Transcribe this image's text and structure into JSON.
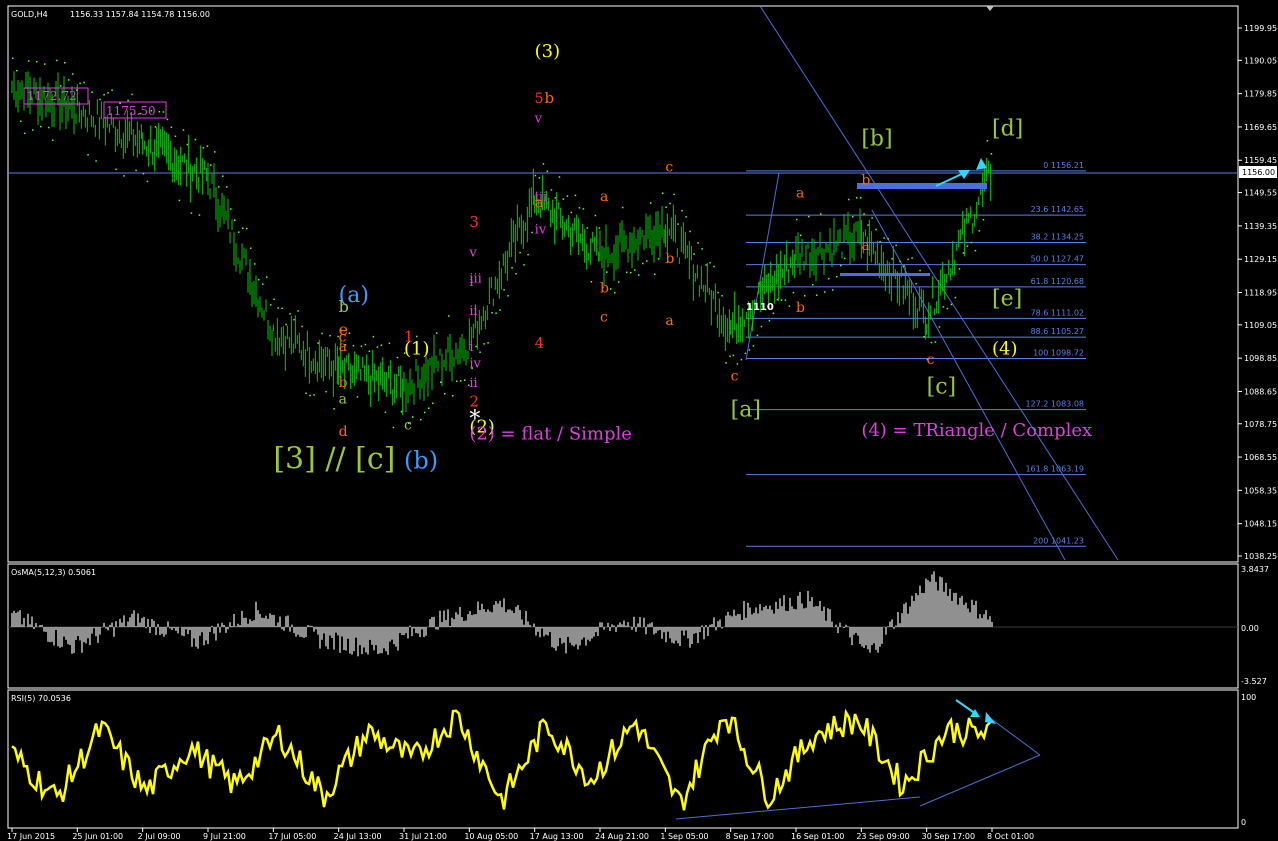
{
  "header": {
    "symbol": "GOLD,H4",
    "ohlc": "1156.33 1157.84 1154.78 1156.00"
  },
  "price_scale": {
    "ticks": [
      "1199.95",
      "1190.05",
      "1179.85",
      "1169.65",
      "1159.45",
      "1149.55",
      "1139.35",
      "1129.15",
      "1118.95",
      "1109.05",
      "1098.85",
      "1088.65",
      "1078.75",
      "1068.55",
      "1058.35",
      "1048.15",
      "1038.25"
    ],
    "current": "1156.00"
  },
  "time_axis": [
    "17 Jun 2015",
    "25 Jun 01:00",
    "2 Jul 09:00",
    "9 Jul 21:00",
    "17 Jul 05:00",
    "24 Jul 13:00",
    "31 Jul 21:00",
    "10 Aug 05:00",
    "17 Aug 13:00",
    "24 Aug 21:00",
    "1 Sep 05:00",
    "8 Sep 17:00",
    "16 Sep 01:00",
    "23 Sep 09:00",
    "30 Sep 17:00",
    "8 Oct 01:00"
  ],
  "price_tags": [
    "1172.72",
    "1175.50"
  ],
  "level_label": "1110",
  "fib_levels": [
    {
      "label": "0 1156.21",
      "price": 1156.21
    },
    {
      "label": "23.6 1142.65",
      "price": 1142.65
    },
    {
      "label": "38.2 1134.25",
      "price": 1134.25
    },
    {
      "label": "50.0 1127.47",
      "price": 1127.47
    },
    {
      "label": "61.8 1120.68",
      "price": 1120.68
    },
    {
      "label": "78.6 1111.02",
      "price": 1111.02
    },
    {
      "label": "88.6 1105.27",
      "price": 1105.27
    },
    {
      "label": "100 1098.72",
      "price": 1098.72
    },
    {
      "label": "127.2 1083.08",
      "price": 1083.08
    },
    {
      "label": "161.8 1063.19",
      "price": 1063.19
    },
    {
      "label": "200 1041.23",
      "price": 1041.23
    }
  ],
  "annotations": [
    {
      "text": "(3)",
      "color": "#ffff00",
      "size": 18,
      "x_date": "17 Aug 13:00",
      "price": 1191
    },
    {
      "text": "5",
      "color": "#ff3030",
      "size": 14,
      "x_date": "17 Aug 13:00",
      "price": 1177
    },
    {
      "text": "b",
      "color": "#ff6a00",
      "size": 15,
      "x_date": "17 Aug 13:00",
      "price": 1177
    },
    {
      "text": "v",
      "color": "#e040e0",
      "size": 13,
      "x_date": "17 Aug 13:00",
      "price": 1171
    },
    {
      "text": "iii",
      "color": "#e040e0",
      "size": 13,
      "x_date": "17 Aug 13:00",
      "price": 1147
    },
    {
      "text": "a",
      "color": "#ff6a00",
      "size": 15,
      "x_date": "17 Aug 13:00",
      "price": 1145
    },
    {
      "text": "iv",
      "color": "#e040e0",
      "size": 13,
      "x_date": "17 Aug 13:00",
      "price": 1137
    },
    {
      "text": "3",
      "color": "#ff3030",
      "size": 15,
      "x_date": "10 Aug 05:00",
      "price": 1139
    },
    {
      "text": "v",
      "color": "#e040e0",
      "size": 13,
      "x_date": "10 Aug 05:00",
      "price": 1130
    },
    {
      "text": "iii",
      "color": "#e040e0",
      "size": 13,
      "x_date": "10 Aug 05:00",
      "price": 1122
    },
    {
      "text": "i",
      "color": "#e040e0",
      "size": 13,
      "x_date": "10 Aug 05:00",
      "price": 1121
    },
    {
      "text": "ii",
      "color": "#e040e0",
      "size": 13,
      "x_date": "10 Aug 05:00",
      "price": 1112
    },
    {
      "text": "4",
      "color": "#ff3030",
      "size": 15,
      "x_date": "17 Aug 13:00",
      "price": 1102
    },
    {
      "text": "1",
      "color": "#ff3030",
      "size": 15,
      "x_date": "31 Jul 21:00",
      "price": 1104
    },
    {
      "text": "i",
      "color": "#e040e0",
      "size": 13,
      "x_date": "10 Aug 05:00",
      "price": 1101
    },
    {
      "text": "iv",
      "color": "#e040e0",
      "size": 13,
      "x_date": "10 Aug 05:00",
      "price": 1096
    },
    {
      "text": "ii",
      "color": "#e040e0",
      "size": 13,
      "x_date": "10 Aug 05:00",
      "price": 1090
    },
    {
      "text": "2",
      "color": "#ff3030",
      "size": 15,
      "x_date": "10 Aug 05:00",
      "price": 1084
    },
    {
      "text": "*",
      "color": "#ffffff",
      "size": 22,
      "x_date": "10 Aug 05:00",
      "price": 1078
    },
    {
      "text": "(2)",
      "color": "#ffff00",
      "size": 18,
      "x_date": "10 Aug 05:00",
      "price": 1076
    },
    {
      "text": "(1)",
      "color": "#ffff00",
      "size": 18,
      "x_date": "31 Jul 21:00",
      "price": 1100
    },
    {
      "text": "(2) = flat / Simple",
      "color": "#e040e0",
      "size": 18,
      "x_date": "10 Aug 05:00",
      "price": 1074
    },
    {
      "text": "(a)",
      "color": "#3a9cff",
      "size": 22,
      "x_date": "24 Jul 13:00",
      "price": 1116
    },
    {
      "text": "b",
      "color": "#9ac832",
      "size": 16,
      "x_date": "24 Jul 13:00",
      "price": 1113
    },
    {
      "text": "e",
      "color": "#ff6a00",
      "size": 16,
      "x_date": "24 Jul 13:00",
      "price": 1106
    },
    {
      "text": "c",
      "color": "#ff6a00",
      "size": 14,
      "x_date": "24 Jul 13:00",
      "price": 1104
    },
    {
      "text": "a",
      "color": "#ff6a00",
      "size": 14,
      "x_date": "24 Jul 13:00",
      "price": 1101
    },
    {
      "text": "b",
      "color": "#ff6a00",
      "size": 14,
      "x_date": "24 Jul 13:00",
      "price": 1090
    },
    {
      "text": "a",
      "color": "#9ac832",
      "size": 14,
      "x_date": "24 Jul 13:00",
      "price": 1085
    },
    {
      "text": "d",
      "color": "#ff6a00",
      "size": 14,
      "x_date": "24 Jul 13:00",
      "price": 1075
    },
    {
      "text": "c",
      "color": "#9ac832",
      "size": 14,
      "x_date": "31 Jul 21:00",
      "price": 1077
    },
    {
      "text": "[3] // [c]",
      "color": "#9ac832",
      "size": 30,
      "x_date": "17 Jul 05:00",
      "price": 1065
    },
    {
      "text": "(b)",
      "color": "#3a9cff",
      "size": 24,
      "x_date": "31 Jul 21:00",
      "price": 1065
    },
    {
      "text": "c",
      "color": "#ff6a00",
      "size": 14,
      "x_date": "24 Aug 21:00",
      "price": 1110
    },
    {
      "text": "b",
      "color": "#ff6a00",
      "size": 14,
      "x_date": "24 Aug 21:00",
      "price": 1119
    },
    {
      "text": "a",
      "color": "#ff6a00",
      "size": 14,
      "x_date": "24 Aug 21:00",
      "price": 1147
    },
    {
      "text": "c",
      "color": "#ff6a00",
      "size": 14,
      "x_date": "1 Sep 05:00",
      "price": 1156
    },
    {
      "text": "b",
      "color": "#ff6a00",
      "size": 14,
      "x_date": "1 Sep 05:00",
      "price": 1128
    },
    {
      "text": "a",
      "color": "#ff6a00",
      "size": 14,
      "x_date": "1 Sep 05:00",
      "price": 1109
    },
    {
      "text": "c",
      "color": "#ff6a00",
      "size": 14,
      "x_date": "8 Sep 17:00",
      "price": 1092
    },
    {
      "text": "[a]",
      "color": "#9ac832",
      "size": 22,
      "x_date": "8 Sep 17:00",
      "price": 1081
    },
    {
      "text": "a",
      "color": "#ff6a00",
      "size": 14,
      "x_date": "16 Sep 01:00",
      "price": 1148
    },
    {
      "text": "b",
      "color": "#ff6a00",
      "size": 14,
      "x_date": "16 Sep 01:00",
      "price": 1113
    },
    {
      "text": "[b]",
      "color": "#9ac832",
      "size": 22,
      "x_date": "23 Sep 09:00",
      "price": 1164
    },
    {
      "text": "b",
      "color": "#ff6a00",
      "size": 14,
      "x_date": "23 Sep 09:00",
      "price": 1152
    },
    {
      "text": "a",
      "color": "#ff6a00",
      "size": 14,
      "x_date": "23 Sep 09:00",
      "price": 1132
    },
    {
      "text": "c",
      "color": "#ff6a00",
      "size": 14,
      "x_date": "30 Sep 17:00",
      "price": 1097
    },
    {
      "text": "[c]",
      "color": "#9ac832",
      "size": 22,
      "x_date": "30 Sep 17:00",
      "price": 1088
    },
    {
      "text": "[d]",
      "color": "#9ac832",
      "size": 22,
      "x_date": "8 Oct 01:00",
      "price": 1167
    },
    {
      "text": "[e]",
      "color": "#9ac832",
      "size": 22,
      "x_date": "8 Oct 01:00",
      "price": 1115
    },
    {
      "text": "(4)",
      "color": "#ffff00",
      "size": 18,
      "x_date": "8 Oct 01:00",
      "price": 1100
    },
    {
      "text": "(4) = TRiangle / Complex",
      "color": "#e040e0",
      "size": 18,
      "x_date": "23 Sep 09:00",
      "price": 1075
    }
  ],
  "osma": {
    "title": "OsMA(5,12,3) 0.5061",
    "ticks": [
      "3.8437",
      "0.00",
      "-3.527"
    ]
  },
  "rsi": {
    "title": "RSI(5) 70.0536",
    "ticks": [
      "100",
      "0"
    ]
  },
  "colors": {
    "bg": "#000000",
    "grid": "#3a3a3a",
    "frame": "#ffffff",
    "candles": "#00cc00",
    "psar": "#66ff33",
    "fib": "#5a7ee6",
    "rsi": "#ffff00",
    "osma": "#c0c0c0",
    "trend": "#4a6fd4",
    "accent": "#33d6ff",
    "box": "#4a6fe0"
  },
  "chart_data": {
    "type": "line",
    "title": "GOLD,H4",
    "x_labels": [
      "17 Jun 2015",
      "25 Jun 01:00",
      "2 Jul 09:00",
      "9 Jul 21:00",
      "17 Jul 05:00",
      "24 Jul 13:00",
      "31 Jul 21:00",
      "10 Aug 05:00",
      "17 Aug 13:00",
      "24 Aug 21:00",
      "1 Sep 05:00",
      "8 Sep 17:00",
      "16 Sep 01:00",
      "23 Sep 09:00",
      "30 Sep 17:00",
      "8 Oct 01:00"
    ],
    "y_range": [
      1038.25,
      1199.95
    ],
    "price_series": [
      {
        "t": "17 Jun 2015",
        "v": 1182
      },
      {
        "t": "25 Jun 01:00",
        "v": 1175
      },
      {
        "t": "2 Jul 09:00",
        "v": 1165
      },
      {
        "t": "9 Jul 21:00",
        "v": 1154
      },
      {
        "t": "17 Jul 05:00",
        "v": 1107
      },
      {
        "t": "24 Jul 13:00",
        "v": 1095
      },
      {
        "t": "31 Jul 21:00",
        "v": 1090
      },
      {
        "t": "10 Aug 05:00",
        "v": 1104
      },
      {
        "t": "17 Aug 13:00",
        "v": 1148
      },
      {
        "t": "24 Aug 21:00",
        "v": 1130
      },
      {
        "t": "1 Sep 05:00",
        "v": 1140
      },
      {
        "t": "8 Sep 17:00",
        "v": 1108
      },
      {
        "t": "16 Sep 01:00",
        "v": 1130
      },
      {
        "t": "23 Sep 09:00",
        "v": 1136
      },
      {
        "t": "30 Sep 17:00",
        "v": 1112
      },
      {
        "t": "8 Oct 01:00",
        "v": 1156
      }
    ],
    "osma_series": {
      "name": "OsMA(5,12,3)",
      "range": [
        -3.527,
        3.8437
      ],
      "values": [
        0.8,
        -1.2,
        0.6,
        -0.9,
        1.1,
        -0.7,
        -1.4,
        0.5,
        1.6,
        -1.3,
        0.4,
        -0.8,
        1.2,
        1.8,
        -1.6,
        3.2,
        0.5
      ]
    },
    "rsi_series": {
      "name": "RSI(5)",
      "range": [
        0,
        100
      ],
      "values": [
        55,
        20,
        75,
        25,
        60,
        30,
        70,
        22,
        72,
        50,
        85,
        18,
        78,
        35,
        80,
        15,
        88,
        22,
        70,
        82,
        30,
        74,
        70
      ]
    }
  }
}
